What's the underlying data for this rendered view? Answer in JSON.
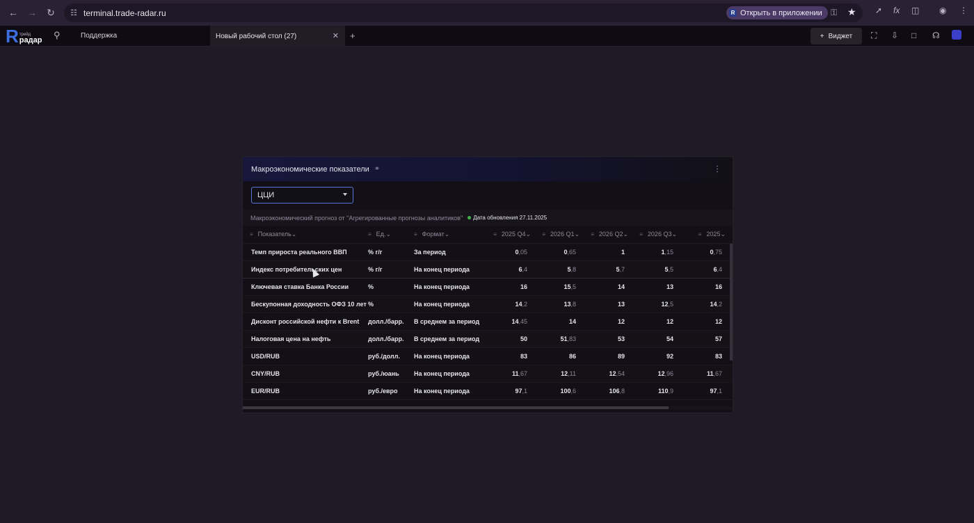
{
  "browser": {
    "url": "terminal.trade-radar.ru",
    "open_in_app": "Открыть в приложении"
  },
  "app": {
    "logo_small": "трейд",
    "logo_name": "радар",
    "support": "Поддержка",
    "tab_title": "Новый рабочий стол (27)",
    "widget_button": "Виджет"
  },
  "panel": {
    "title": "Макроэкономические показатели",
    "select_value": "ЦЦИ",
    "source_text": "Макроэкономический прогноз от \"Агрегированные прогнозы аналитиков\"",
    "updated_text": "Дата обновления 27.11.2025",
    "columns": [
      "Показатель",
      "Ед.",
      "Формат",
      "2025 Q4",
      "2026 Q1",
      "2026 Q2",
      "2026 Q3",
      "2025"
    ],
    "rows": [
      {
        "name": "Темп прироста реального ВВП",
        "unit": "% г/г",
        "format": "За период",
        "v": [
          [
            "0",
            ",05"
          ],
          [
            "0",
            ",65"
          ],
          [
            "1",
            ""
          ],
          [
            "1",
            ",15"
          ],
          [
            "0",
            ",75"
          ]
        ]
      },
      {
        "name": "Индекс потребительских цен",
        "unit": "% г/г",
        "format": "На конец периода",
        "v": [
          [
            "6",
            ",4"
          ],
          [
            "5",
            ",8"
          ],
          [
            "5",
            ",7"
          ],
          [
            "5",
            ",5"
          ],
          [
            "6",
            ",4"
          ]
        ]
      },
      {
        "name": "Ключевая ставка Банка России",
        "unit": "%",
        "format": "На конец периода",
        "v": [
          [
            "16",
            ""
          ],
          [
            "15",
            ",5"
          ],
          [
            "14",
            ""
          ],
          [
            "13",
            ""
          ],
          [
            "16",
            ""
          ]
        ]
      },
      {
        "name": "Бескупонная доходность ОФЗ 10 лет",
        "unit": "%",
        "format": "На конец периода",
        "v": [
          [
            "14",
            ",2"
          ],
          [
            "13",
            ",8"
          ],
          [
            "13",
            ""
          ],
          [
            "12",
            ",5"
          ],
          [
            "14",
            ",2"
          ]
        ]
      },
      {
        "name": "Дисконт российской нефти к Brent",
        "unit": "долл./барр.",
        "format": "В среднем за период",
        "v": [
          [
            "14",
            ",45"
          ],
          [
            "14",
            ""
          ],
          [
            "12",
            ""
          ],
          [
            "12",
            ""
          ],
          [
            "12",
            ""
          ]
        ]
      },
      {
        "name": "Налоговая цена на нефть",
        "unit": "долл./барр.",
        "format": "В среднем за период",
        "v": [
          [
            "50",
            ""
          ],
          [
            "51",
            ",83"
          ],
          [
            "53",
            ""
          ],
          [
            "54",
            ""
          ],
          [
            "57",
            ""
          ]
        ]
      },
      {
        "name": "USD/RUB",
        "unit": "руб./долл.",
        "format": "На конец периода",
        "v": [
          [
            "83",
            ""
          ],
          [
            "86",
            ""
          ],
          [
            "89",
            ""
          ],
          [
            "92",
            ""
          ],
          [
            "83",
            ""
          ]
        ]
      },
      {
        "name": "CNY/RUB",
        "unit": "руб./юань",
        "format": "На конец периода",
        "v": [
          [
            "11",
            ",67"
          ],
          [
            "12",
            ",11"
          ],
          [
            "12",
            ",54"
          ],
          [
            "12",
            ",96"
          ],
          [
            "11",
            ",67"
          ]
        ]
      },
      {
        "name": "EUR/RUB",
        "unit": "руб./евро",
        "format": "На конец периода",
        "v": [
          [
            "97",
            ",1"
          ],
          [
            "100",
            ",6"
          ],
          [
            "106",
            ",8"
          ],
          [
            "110",
            ",9"
          ],
          [
            "97",
            ",1"
          ]
        ]
      }
    ]
  }
}
